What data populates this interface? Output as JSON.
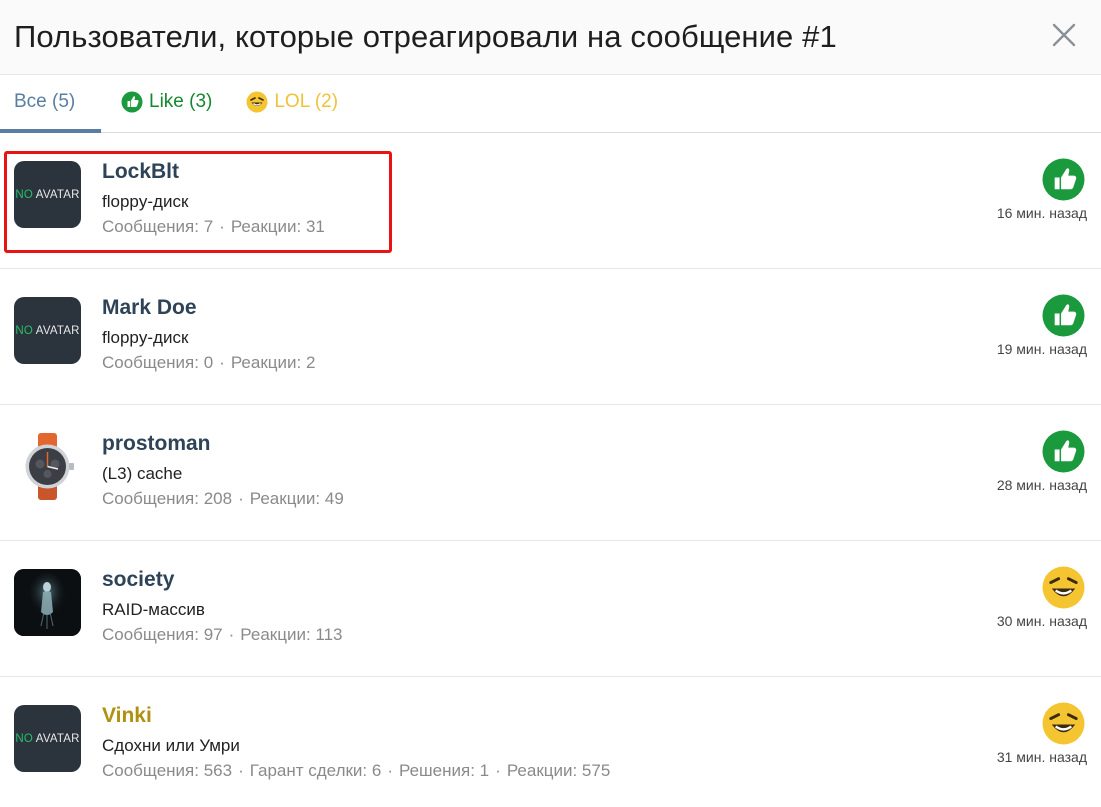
{
  "header": {
    "title": "Пользователи, которые отреагировали на сообщение #1"
  },
  "tabs": [
    {
      "label": "Все (5)",
      "icon": null,
      "active": true
    },
    {
      "label": "Like (3)",
      "icon": "like-icon",
      "active": false
    },
    {
      "label": "LOL (2)",
      "icon": "lol-icon",
      "active": false
    }
  ],
  "avatar_placeholder": {
    "no": "NO",
    "avatar": "AVATAR"
  },
  "users": [
    {
      "name": "LockBlt",
      "title": "floppy-диск",
      "stats": [
        "Сообщения: 7",
        "Реакции: 31"
      ],
      "reaction": "like-icon",
      "time": "16 мин. назад",
      "avatar": "no-avatar",
      "name_color": "#2e4357"
    },
    {
      "name": "Mark Doe",
      "title": "floppy-диск",
      "stats": [
        "Сообщения: 0",
        "Реакции: 2"
      ],
      "reaction": "like-icon",
      "time": "19 мин. назад",
      "avatar": "no-avatar",
      "name_color": "#2e4357"
    },
    {
      "name": "prostoman",
      "title": "(L3) cache",
      "stats": [
        "Сообщения: 208",
        "Реакции: 49"
      ],
      "reaction": "like-icon",
      "time": "28 мин. назад",
      "avatar": "watch-avatar",
      "name_color": "#2e4357"
    },
    {
      "name": "society",
      "title": "RAID-массив",
      "stats": [
        "Сообщения: 97",
        "Реакции: 113"
      ],
      "reaction": "lol-icon",
      "time": "30 мин. назад",
      "avatar": "ghost-avatar",
      "name_color": "#2e4357"
    },
    {
      "name": "Vinki",
      "title": "Сдохни или Умри",
      "stats": [
        "Сообщения: 563",
        "Гарант сделки: 6",
        "Решения: 1",
        "Реакции: 575"
      ],
      "reaction": "lol-icon",
      "time": "31 мин. назад",
      "avatar": "no-avatar",
      "name_color": "#b0900f"
    }
  ],
  "colors": {
    "accent": "#587ea3",
    "like": "#15882f",
    "lol": "#f0c23a",
    "highlight": "#e81414"
  }
}
